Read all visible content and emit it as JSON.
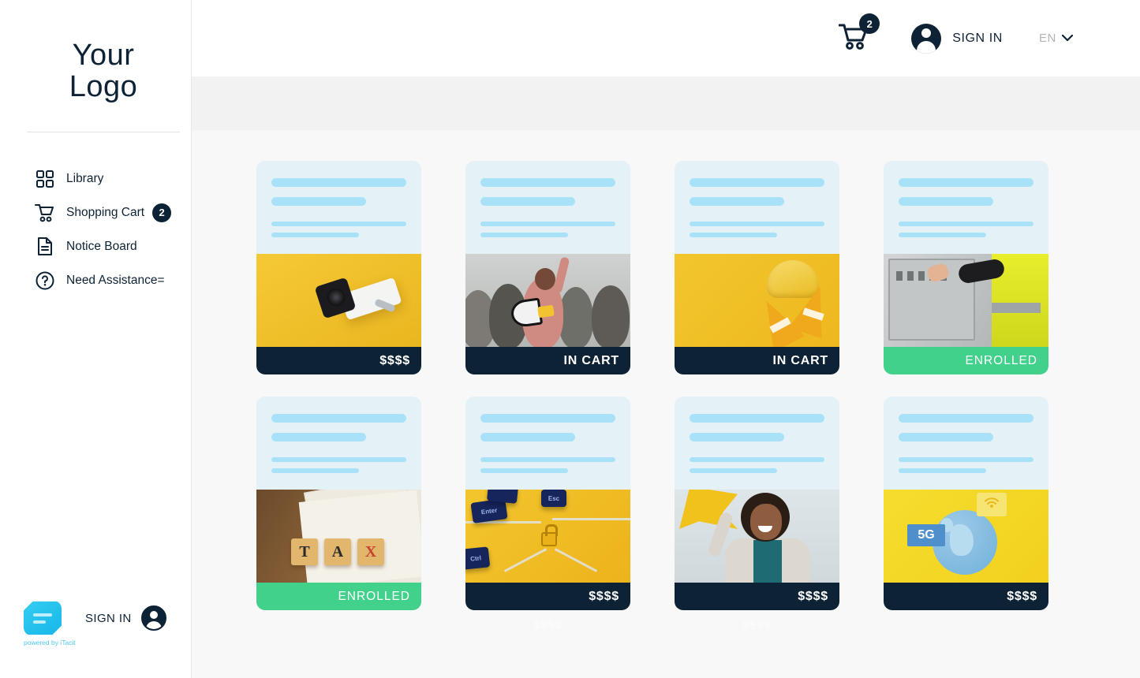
{
  "brand": {
    "logo_line1": "Your",
    "logo_line2": "Logo",
    "powered_by": "powered by iTacit"
  },
  "sidebar": {
    "items": [
      {
        "label": "Library",
        "icon": "grid-icon",
        "badge": null
      },
      {
        "label": "Shopping Cart",
        "icon": "cart-icon",
        "badge": "2"
      },
      {
        "label": "Notice Board",
        "icon": "document-icon",
        "badge": null
      },
      {
        "label": "Need Assistance=",
        "icon": "question-circle-icon",
        "badge": null
      }
    ],
    "sign_in_label": "SIGN IN"
  },
  "header": {
    "cart_badge": "2",
    "sign_in_label": "SIGN IN",
    "language": "EN"
  },
  "cards": [
    {
      "status": "$$$$",
      "status_type": "price",
      "image": "security-camera-image"
    },
    {
      "status": "IN CART",
      "status_type": "in-cart",
      "image": "megaphone-crowd-image"
    },
    {
      "status": "IN CART",
      "status_type": "in-cart",
      "image": "hard-hat-cones-image"
    },
    {
      "status": "ENROLLED",
      "status_type": "enrolled",
      "image": "electrical-panel-image"
    },
    {
      "status": "ENROLLED",
      "status_type": "enrolled",
      "image": "tax-forms-image"
    },
    {
      "status": "$$$$",
      "status_type": "price",
      "image": "cybersecurity-lock-image"
    },
    {
      "status": "$$$$",
      "status_type": "price",
      "image": "office-woman-star-image"
    },
    {
      "status": "$$$$",
      "status_type": "price",
      "image": "5g-globe-image"
    }
  ],
  "ghost_prices": [
    "",
    "$$$$",
    "$$$$",
    ""
  ],
  "colors": {
    "navy": "#0d2235",
    "green": "#41d18b",
    "yellow": "#f3c62e",
    "skeleton_bg": "#e4f2f8",
    "skeleton_bar": "#a9e2f8",
    "cyan": "#4fc9ee"
  }
}
